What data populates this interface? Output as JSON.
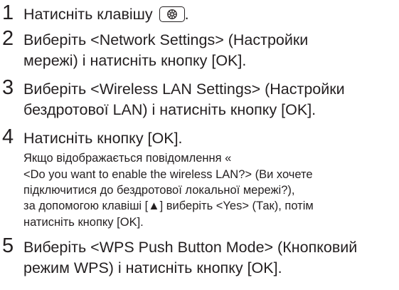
{
  "steps": [
    {
      "number": "1",
      "line1_before": "Натисніть клавішу ",
      "key_icon": "menu-key-icon",
      "line1_after": "."
    },
    {
      "number": "2",
      "line1": "Виберіть <Network Settings> (Настройки",
      "line2": "мережі) і натисніть кнопку [OK]."
    },
    {
      "number": "3",
      "line1": "Виберіть <Wireless LAN Settings> (Настройки",
      "line2": "бездротової LAN) і натисніть кнопку [OK]."
    },
    {
      "number": "4",
      "line1": "Натисніть кнопку [OK].",
      "note_lines": [
        "Якщо відображається повідомлення «",
        "<Do you want to enable the wireless LAN?> (Ви хочете",
        "підключитися до бездротової локальної мережі?),",
        "за допомогою клавіші [▲] виберіть <Yes> (Так), потім",
        "натисніть кнопку [OK]."
      ]
    },
    {
      "number": "5",
      "line1": "Виберіть <WPS Push Button Mode> (Кнопковий",
      "line2": "режим WPS) і натисніть кнопку [OK]."
    }
  ]
}
